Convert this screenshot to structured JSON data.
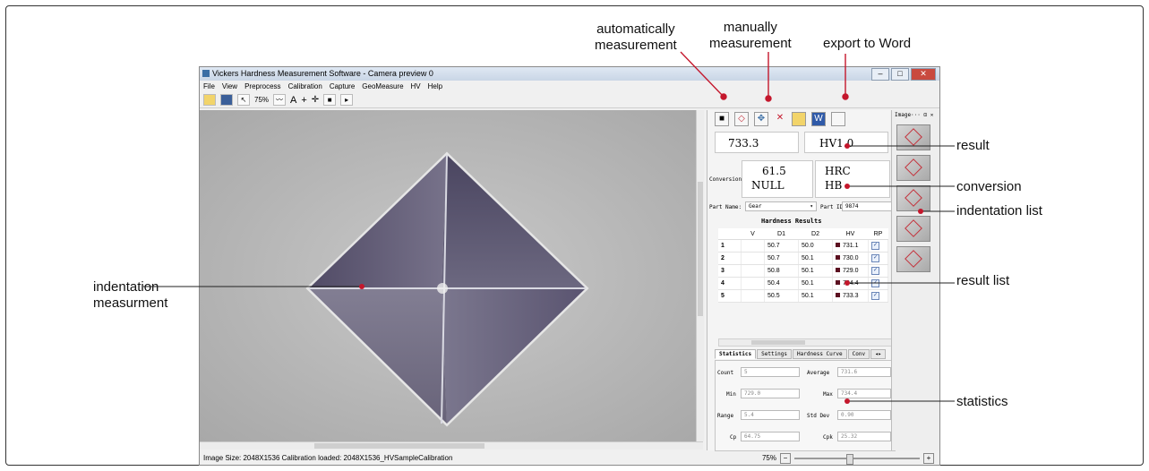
{
  "callouts": {
    "auto": "automatically\nmeasurement",
    "manual": "manually\nmeasurement",
    "export": "export to Word",
    "result": "result",
    "conversion": "conversion",
    "indentation_list": "indentation list",
    "result_list": "result list",
    "statistics": "statistics",
    "indentation_measure": "indentation\nmeasurment"
  },
  "window": {
    "title": "Vickers Hardness Measurement Software - Camera preview 0",
    "menus": [
      "File",
      "View",
      "Preprocess",
      "Calibration",
      "Capture",
      "GeoMeasure",
      "HV",
      "Help"
    ],
    "zoom_combo": "75%",
    "text_tool": "A",
    "status": "Image Size: 2048X1536  Calibration loaded: 2048X1536_HVSampleCalibration",
    "zoom_level": "75%"
  },
  "panel": {
    "result_value": "733.3",
    "result_unit": "HV1.0",
    "conversion_label": "Conversion",
    "conv_value1": "61.5",
    "conv_value2": "NULL",
    "conv_unit1": "HRC",
    "conv_unit2": "HB",
    "part_name_label": "Part Name:",
    "part_name": "Gear",
    "part_id_label": "Part ID:",
    "part_id": "9874",
    "results_title": "Hardness Results",
    "columns": [
      "",
      "V",
      "D1",
      "D2",
      "HV",
      "RP"
    ],
    "rows": [
      {
        "n": "1",
        "d1": "50.7",
        "d2": "50.0",
        "hv": "731.1"
      },
      {
        "n": "2",
        "d1": "50.7",
        "d2": "50.1",
        "hv": "730.0"
      },
      {
        "n": "3",
        "d1": "50.8",
        "d2": "50.1",
        "hv": "729.0"
      },
      {
        "n": "4",
        "d1": "50.4",
        "d2": "50.1",
        "hv": "734.4"
      },
      {
        "n": "5",
        "d1": "50.5",
        "d2": "50.1",
        "hv": "733.3"
      }
    ],
    "tabs": [
      "Statistics",
      "Settings",
      "Hardness Curve",
      "Conv"
    ],
    "stats": {
      "count_label": "Count",
      "count": "5",
      "average_label": "Average",
      "average": "731.6",
      "min_label": "Min",
      "min": "729.0",
      "max_label": "Max",
      "max": "734.4",
      "range_label": "Range",
      "range": "5.4",
      "stddev_label": "Std Dev",
      "stddev": "0.90",
      "cp_label": "Cp",
      "cp": "64.75",
      "cpk_label": "Cpk",
      "cpk": "25.32"
    }
  },
  "thumbs": {
    "header": "Image···"
  },
  "colors": {
    "callout_dot": "#c4172c",
    "thumb_border": "#8a8a8a"
  }
}
